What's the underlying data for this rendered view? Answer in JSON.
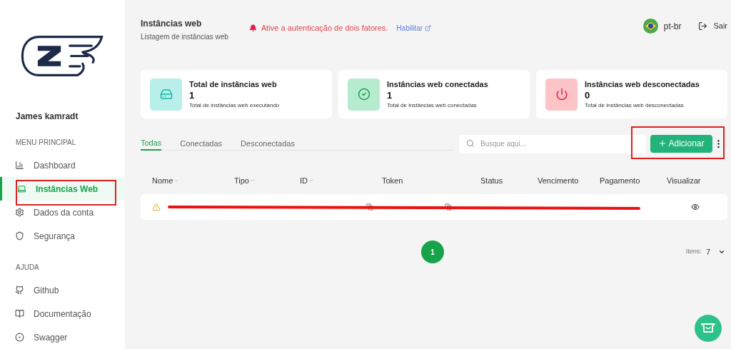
{
  "sidebar": {
    "user": "James kamradt",
    "sections": [
      {
        "title": "MENU PRINCIPAL",
        "items": [
          {
            "label": "Dashboard",
            "selected": false
          },
          {
            "label": "Instâncias Web",
            "selected": true
          },
          {
            "label": "Dados da conta",
            "selected": false
          },
          {
            "label": "Segurança",
            "selected": false
          }
        ]
      },
      {
        "title": "AJUDA",
        "items": [
          {
            "label": "Github",
            "selected": false
          },
          {
            "label": "Documentação",
            "selected": false
          },
          {
            "label": "Swagger",
            "selected": false
          }
        ]
      }
    ]
  },
  "header": {
    "title": "Instâncias web",
    "subtitle": "Listagem de instâncias web",
    "alert": "Ative a autenticação de dois fatores.",
    "alert_link": "Habilitar",
    "language": "pt-br",
    "logout": "Sair"
  },
  "stats": [
    {
      "kind": "total",
      "title": "Total de instâncias web",
      "value": "1",
      "caption": "Total de instâncias web executando"
    },
    {
      "kind": "connected",
      "title": "Instâncias web conectadas",
      "value": "1",
      "caption": "Total de instâncias web conectadas"
    },
    {
      "kind": "disconnected",
      "title": "Instâncias web desconectadas",
      "value": "0",
      "caption": "Total de instâncias web desconectadas"
    }
  ],
  "tabs": [
    {
      "label": "Todas",
      "selected": true
    },
    {
      "label": "Conectadas",
      "selected": false
    },
    {
      "label": "Desconectadas",
      "selected": false
    }
  ],
  "search": {
    "placeholder": "Busque aqui..."
  },
  "add_button": "Adicionar",
  "table": {
    "columns": [
      {
        "label": "Nome",
        "sortable": true
      },
      {
        "label": "Tipo",
        "sortable": true
      },
      {
        "label": "ID",
        "sortable": true
      },
      {
        "label": "Token",
        "sortable": false
      },
      {
        "label": "Status",
        "sortable": false
      },
      {
        "label": "Vencimento",
        "sortable": false
      },
      {
        "label": "Pagamento",
        "sortable": false
      },
      {
        "label": "Visualizar",
        "sortable": false
      }
    ]
  },
  "pagination": {
    "pages": [
      {
        "label": "1",
        "selected": true
      }
    ],
    "items_label": "Itens:",
    "items_value": "7"
  }
}
